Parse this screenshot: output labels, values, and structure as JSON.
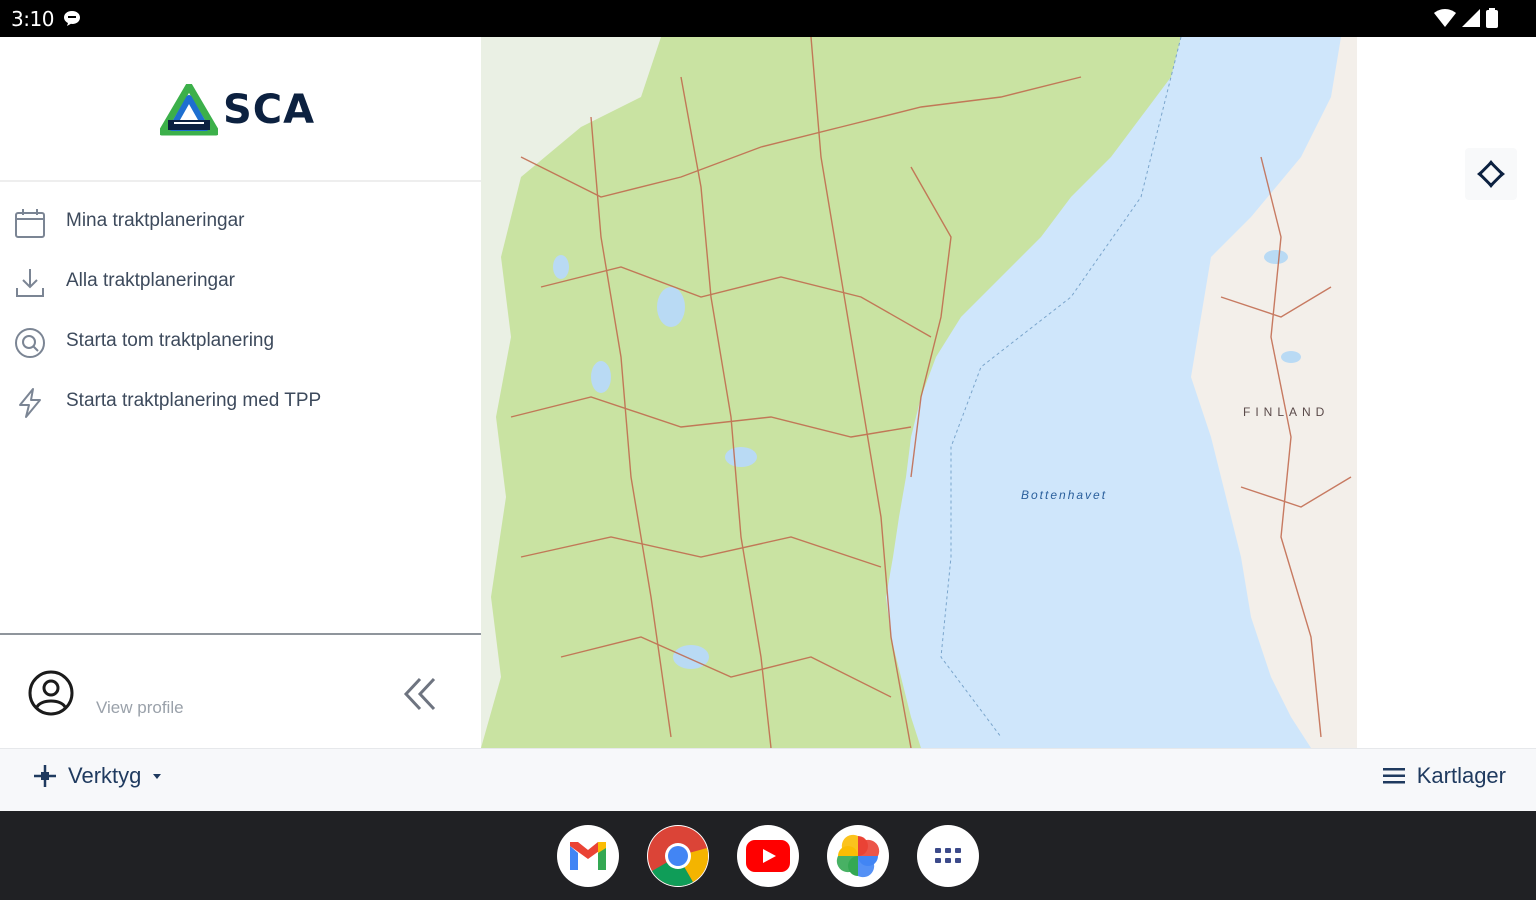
{
  "status_bar": {
    "time": "3:10",
    "icons": [
      "message-icon",
      "wifi-icon",
      "signal-icon",
      "battery-icon"
    ]
  },
  "brand": {
    "name": "SCA",
    "colors": {
      "navy": "#0c2140",
      "green": "#3cb04a",
      "blue": "#1e6fd0"
    }
  },
  "sidebar": {
    "items": [
      {
        "label": "Mina traktplaneringar",
        "icon": "calendar-icon"
      },
      {
        "label": "Alla traktplaneringar",
        "icon": "download-icon"
      },
      {
        "label": "Starta tom traktplanering",
        "icon": "target-search-icon"
      },
      {
        "label": "Starta traktplanering med TPP",
        "icon": "lightning-icon"
      }
    ],
    "profile": {
      "label": "View profile",
      "icon": "user-circle-icon"
    },
    "collapse_icon": "double-chevron-left-icon"
  },
  "map": {
    "labels": {
      "sea": "Bottenhavet",
      "country": "FINLAND"
    }
  },
  "toolbar": {
    "tools_label": "Verktyg",
    "tools_icon": "move-cross-icon",
    "layers_label": "Kartlager",
    "layers_icon": "menu-lines-icon"
  },
  "dock": {
    "apps": [
      "Gmail",
      "Chrome",
      "YouTube",
      "Photos",
      "App drawer"
    ]
  }
}
